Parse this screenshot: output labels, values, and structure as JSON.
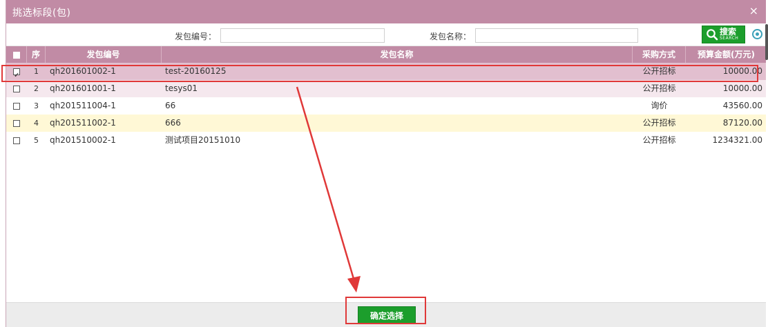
{
  "dialog": {
    "title": "挑选标段(包)",
    "close_glyph": "×"
  },
  "search": {
    "code_label": "发包编号：",
    "code_value": "",
    "name_label": "发包名称：",
    "name_value": "",
    "button_text": "搜索",
    "button_subtext": "SEARCH"
  },
  "grid": {
    "columns": [
      "序",
      "发包编号",
      "发包名称",
      "采购方式",
      "预算金额(万元)"
    ],
    "rows": [
      {
        "checked": true,
        "no": "1",
        "code": "qh201601002-1",
        "name": "test-20160125",
        "method": "公开招标",
        "amount": "10000.00"
      },
      {
        "checked": false,
        "no": "2",
        "code": "qh201601001-1",
        "name": "tesys01",
        "method": "公开招标",
        "amount": "10000.00"
      },
      {
        "checked": false,
        "no": "3",
        "code": "qh201511004-1",
        "name": "66",
        "method": "询价",
        "amount": "43560.00"
      },
      {
        "checked": false,
        "no": "4",
        "code": "qh201511002-1",
        "name": "666",
        "method": "公开招标",
        "amount": "87120.00"
      },
      {
        "checked": false,
        "no": "5",
        "code": "qh201510002-1",
        "name": "测试项目20151010",
        "method": "公开招标",
        "amount": "1234321.00"
      }
    ]
  },
  "footer": {
    "confirm_label": "确定选择"
  },
  "colors": {
    "accent": "#c18ba5",
    "button_green": "#1c9e2c",
    "annotation_red": "#e03838"
  }
}
